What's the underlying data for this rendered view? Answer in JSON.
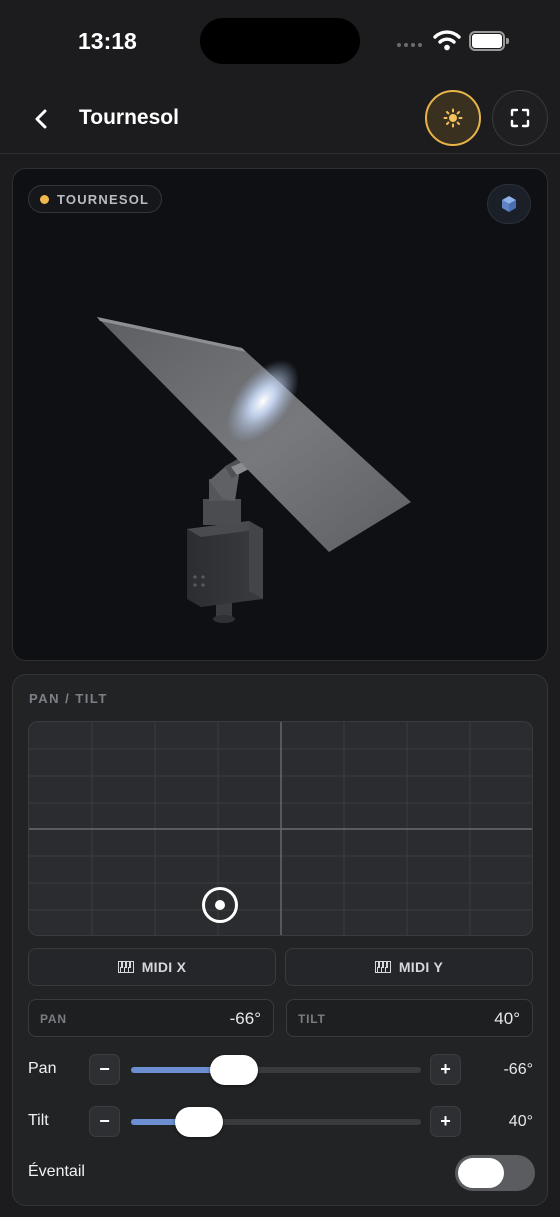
{
  "status_bar": {
    "time": "13:18",
    "icons": [
      "cellular-signal-icon",
      "wifi-icon",
      "battery-icon"
    ]
  },
  "header": {
    "title": "Tournesol",
    "back_icon": "chevron-left-icon",
    "light_icon": "sun-icon",
    "fullscreen_icon": "fullscreen-icon"
  },
  "viewport": {
    "device_chip_label": "TOURNESOL",
    "cube_icon": "cube-icon"
  },
  "controls": {
    "section_title": "PAN / TILT",
    "pad_position": {
      "pan_fraction": 0.378,
      "tilt_fraction": 0.85
    },
    "midi_x_label": "MIDI X",
    "midi_y_label": "MIDI Y",
    "midi_icon": "piano-keys-icon",
    "pan_field": {
      "label": "PAN",
      "value": "-66°"
    },
    "tilt_field": {
      "label": "TILT",
      "value": "40°"
    },
    "pan_slider": {
      "label": "Pan",
      "value": "-66°",
      "fraction": 0.32,
      "minus": "−",
      "plus": "+"
    },
    "tilt_slider": {
      "label": "Tilt",
      "value": "40°",
      "fraction": 0.2,
      "minus": "−",
      "plus": "+"
    },
    "fan_toggle": {
      "label": "Éventail",
      "on": false
    }
  },
  "colors": {
    "accent": "#e8b44a",
    "slider_fill": "#6b8fd0",
    "chip_dot": "#f0b84c",
    "cube_icon": "#6d93d8"
  }
}
